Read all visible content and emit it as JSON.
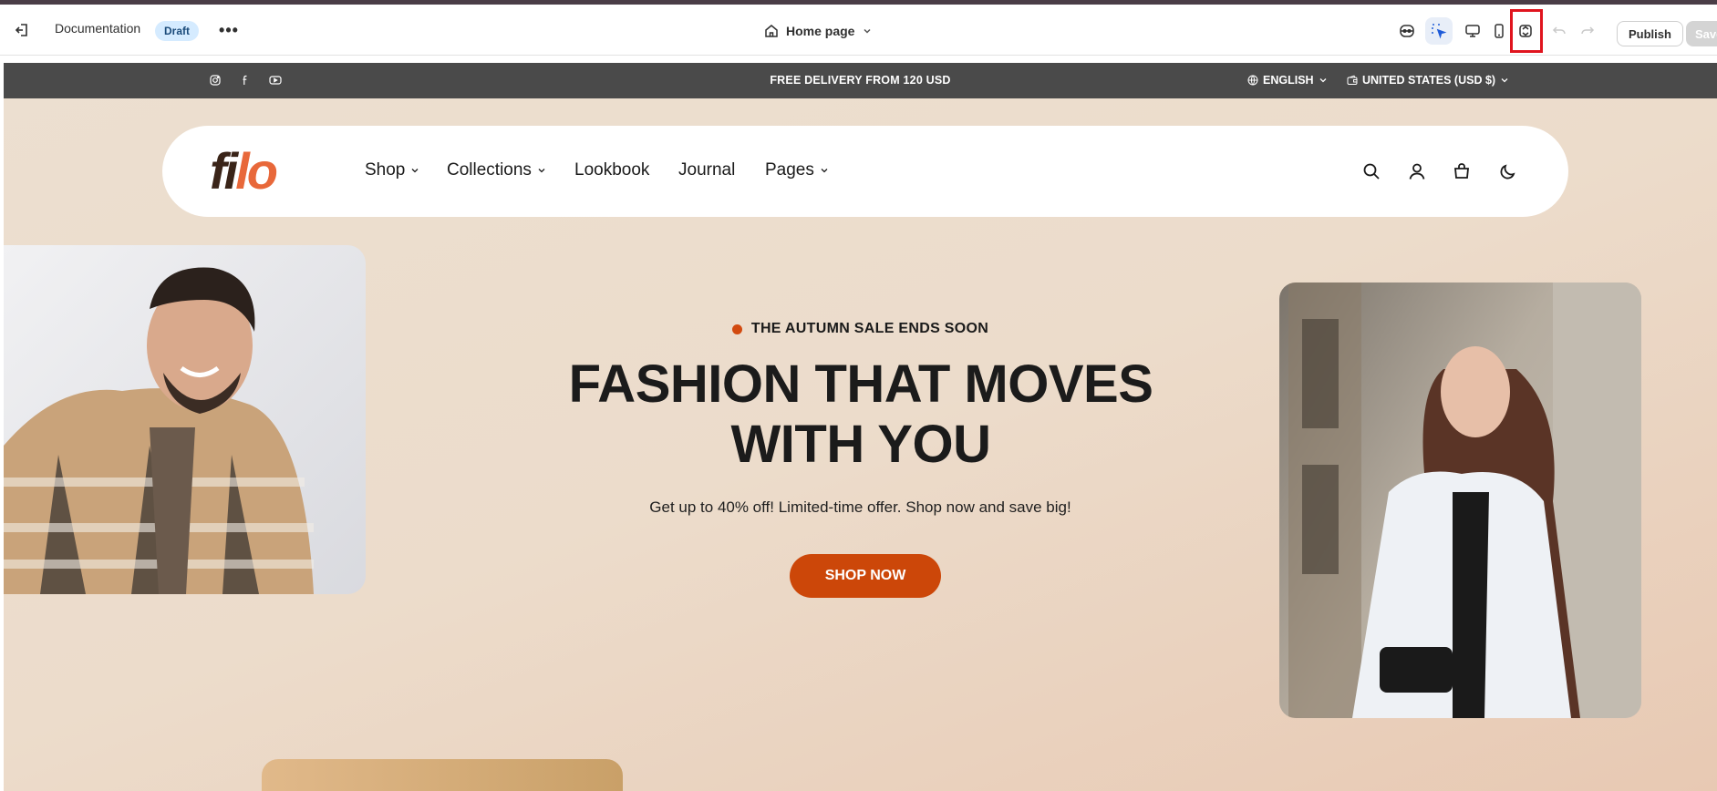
{
  "editor": {
    "doc_title": "Documentation",
    "status_badge": "Draft",
    "more_label": "•••",
    "page_selector": "Home page",
    "publish_label": "Publish",
    "save_label": "Save",
    "accent_highlight": "#e0141e"
  },
  "announcement": {
    "text": "FREE DELIVERY FROM 120 USD",
    "language": "ENGLISH",
    "country": "UNITED STATES (USD $)",
    "social": [
      "instagram-icon",
      "facebook-icon",
      "youtube-icon"
    ]
  },
  "header": {
    "logo_part1": "fi",
    "logo_part2": "lo",
    "nav": {
      "shop": "Shop",
      "collections": "Collections",
      "lookbook": "Lookbook",
      "journal": "Journal",
      "pages": "Pages"
    }
  },
  "hero": {
    "eyebrow": "THE AUTUMN SALE ENDS SOON",
    "headline_line1": "FASHION THAT MOVES",
    "headline_line2": "WITH YOU",
    "subtext": "Get up to 40% off! Limited-time offer. Shop now and save big!",
    "cta": "SHOP NOW",
    "accent_color": "#cc4709"
  }
}
